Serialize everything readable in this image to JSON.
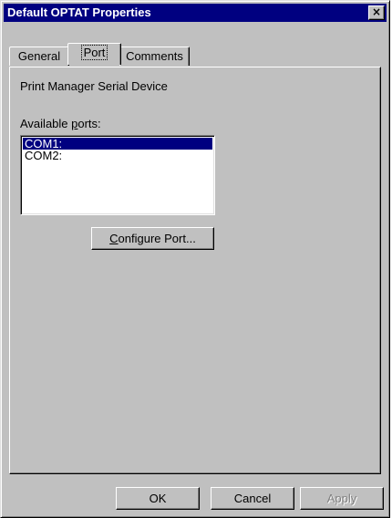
{
  "window": {
    "title": "Default OPTAT Properties",
    "close_label": "×"
  },
  "tabs": [
    {
      "label": "General",
      "active": false
    },
    {
      "label": "Port",
      "active": true
    },
    {
      "label": "Comments",
      "active": false
    }
  ],
  "port_panel": {
    "device_name": "Print Manager Serial Device",
    "ports_label_prefix": "Available ",
    "ports_label_accel": "p",
    "ports_label_suffix": "orts:",
    "ports": [
      {
        "name": "COM1:",
        "selected": true
      },
      {
        "name": "COM2:",
        "selected": false
      }
    ],
    "configure_button_accel": "C",
    "configure_button_rest": "onfigure Port..."
  },
  "footer": {
    "ok_label": "OK",
    "cancel_label": "Cancel",
    "apply_label": "Apply",
    "apply_enabled": false
  },
  "colors": {
    "titlebar": "#000080",
    "selection": "#000080",
    "face": "#c0c0c0"
  }
}
